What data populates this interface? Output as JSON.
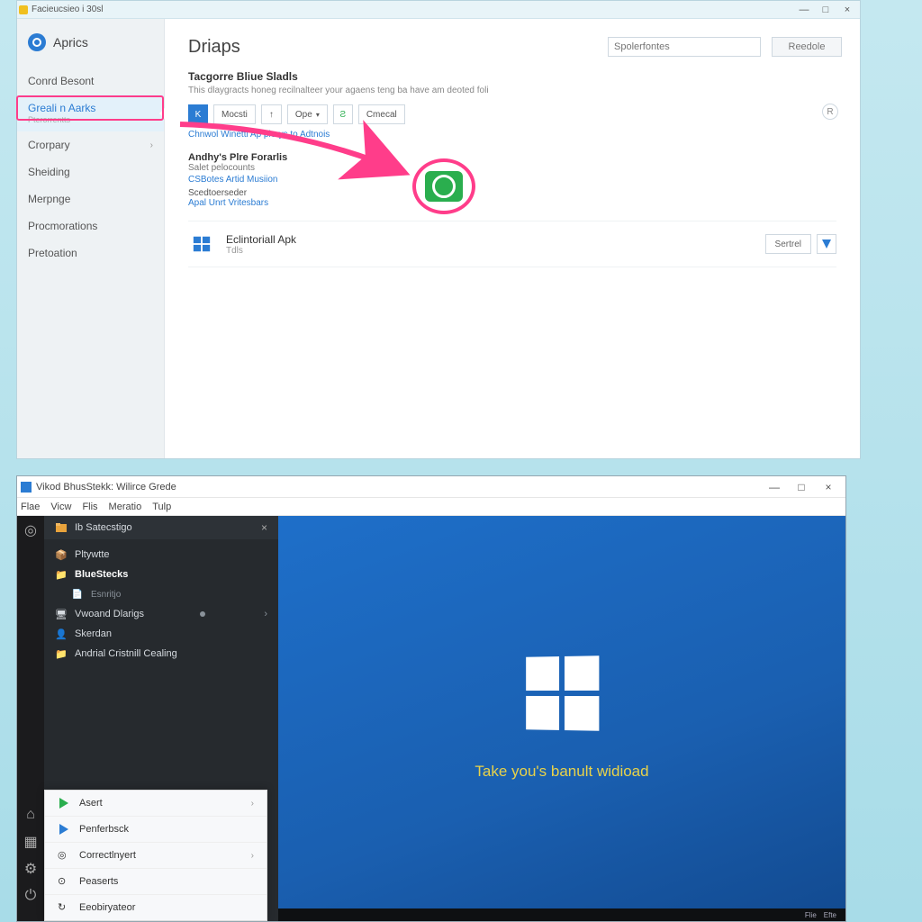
{
  "win1": {
    "title": "Facieucsieo i 30sl",
    "brand": "Aprics",
    "nav": [
      "Conrd Besont",
      "Greali n Aarks",
      "Pterorrentts",
      "Crorpary",
      "Sheiding",
      "Merpnge",
      "Procmorations",
      "Pretoation"
    ],
    "page_title": "Driaps",
    "search_placeholder": "Spolerfontes",
    "restore": "Reedole",
    "sec_heading": "Tacgorre Bliue Sladls",
    "sec_sub": "This dlaygracts honeg recilnalteer your agaens teng ba have am deoted foli",
    "tool_moods": "Mocsti",
    "tool_ops": "Ope",
    "tool_cancel": "Cmecal",
    "link_line": "Chnwol Winetti Ap plorys to Adtnois",
    "sub_heading": "Andhy's Plre Forarlis",
    "line_salet": "Salet pelocounts",
    "line_cs": "CSBotes Artid Musiion",
    "label_sced": "Scedtoerseder",
    "line_apal": "Apal Unrt Vritesbars",
    "app_name": "Eclintoriall Apk",
    "app_meta": "Tdls",
    "app_action": "Sertrel"
  },
  "win2": {
    "title": "Vikod BhusStekk: Wilirce Grede",
    "menu": [
      "Flae",
      "Vicw",
      "Flis",
      "Meratio",
      "Tulp"
    ],
    "tab": "Ib Satecstigo",
    "tree": {
      "p1": "Pltywtte",
      "p2": "BlueStecks",
      "p2s": "Esnritjo",
      "p3": "Vwoand Dlarigs",
      "p4": "Skerdan",
      "p5": "Andrial Cristnill Cealing"
    },
    "start": [
      "Asert",
      "Penferbsck",
      "Correctlnyert",
      "Peaserts",
      "Eeobiryateor"
    ],
    "tagline": "Take you's banult widioad",
    "task1": "Flie",
    "task2": "Efte"
  }
}
